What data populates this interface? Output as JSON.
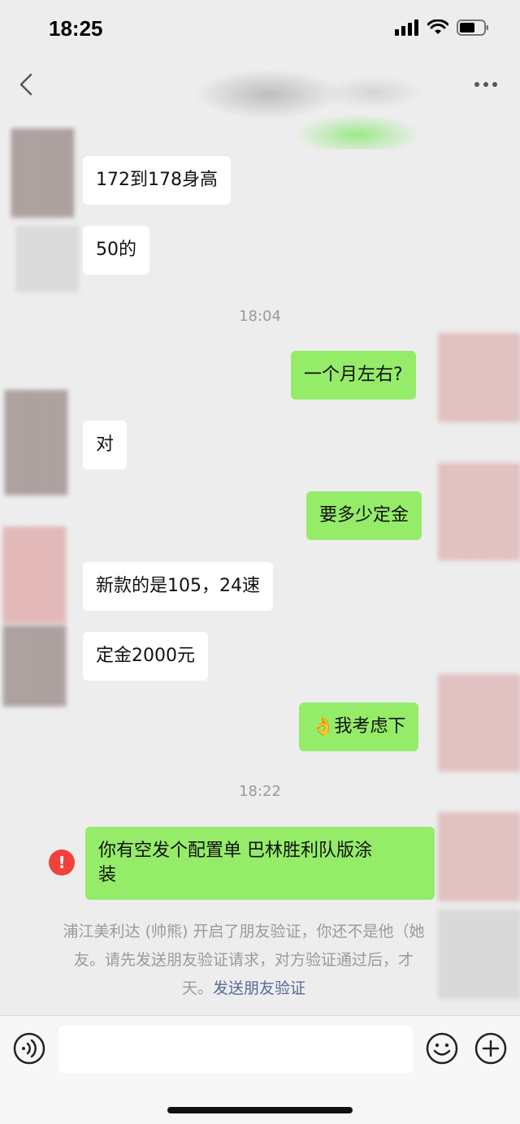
{
  "status_bar": {
    "time": "18:25"
  },
  "nav": {
    "back_label": "",
    "more_label": ""
  },
  "messages": {
    "m1": "172到178身高",
    "m2": "50的",
    "t1": "18:04",
    "m3": "一个月左右?",
    "m4": "对",
    "m5": "要多少定金",
    "m6": "新款的是105，24速",
    "m7": "定金2000元",
    "m8": "👌我考虑下",
    "t2": "18:22",
    "m9_line1": "你有空发个配置单  巴林胜利队版涂",
    "m9_line2": "装"
  },
  "system_notice": {
    "line1": "浦江美利达 (帅熊) 开启了朋友验证，你还不是他（她",
    "line2": "友。请先发送朋友验证请求，对方验证通过后，才",
    "line3_prefix": "天。",
    "link": "发送朋友验证"
  },
  "error_icon_glyph": "!",
  "input": {
    "placeholder": "",
    "value": ""
  },
  "colors": {
    "outgoing_bubble": "#95ec69",
    "incoming_bubble": "#ffffff",
    "background": "#ededed",
    "error": "#f2403a",
    "link": "#576b95"
  }
}
